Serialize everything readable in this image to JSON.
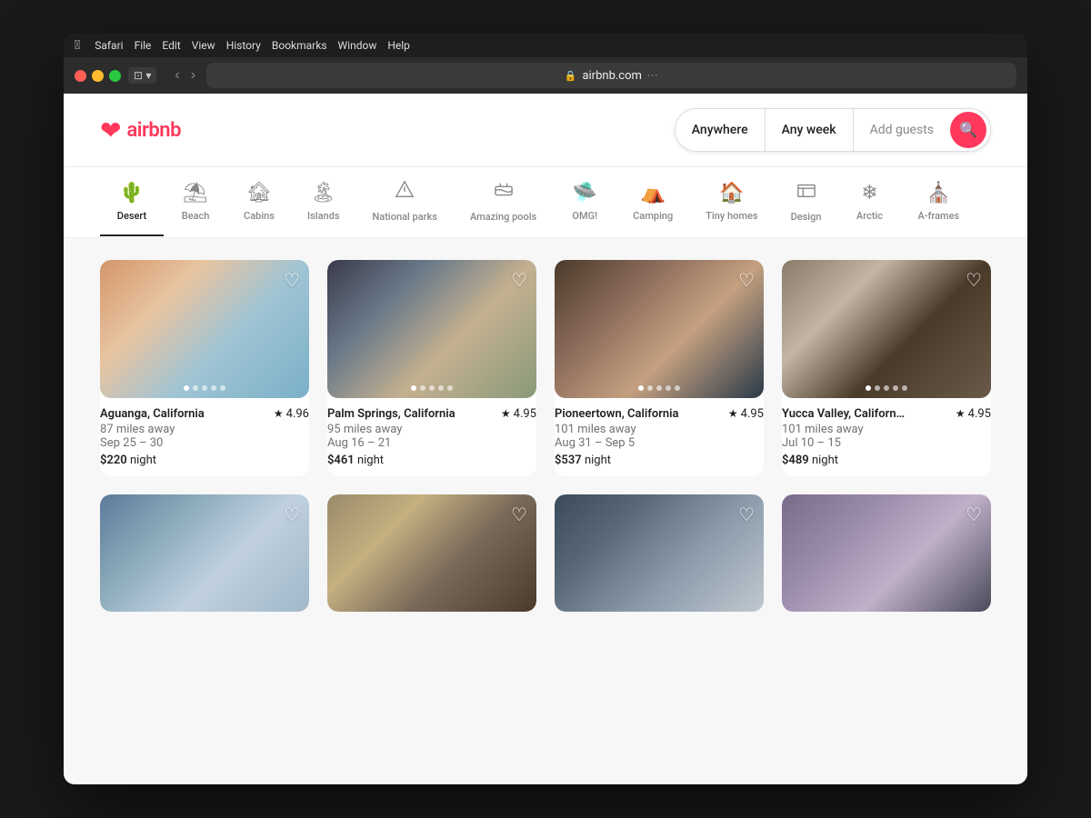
{
  "menubar": {
    "apple": "🍎",
    "items": [
      "Safari",
      "File",
      "Edit",
      "View",
      "History",
      "Bookmarks",
      "Window",
      "Help"
    ]
  },
  "toolbar": {
    "url": "airbnb.com"
  },
  "header": {
    "logo_text": "airbnb",
    "search": {
      "anywhere": "Anywhere",
      "any_week": "Any week",
      "guests": "Add guests"
    }
  },
  "categories": [
    {
      "id": "desert",
      "label": "Desert",
      "icon": "🌵",
      "active": true
    },
    {
      "id": "beach",
      "label": "Beach",
      "icon": "⛱",
      "active": false
    },
    {
      "id": "cabins",
      "label": "Cabins",
      "icon": "🏚",
      "active": false
    },
    {
      "id": "islands",
      "label": "Islands",
      "icon": "🏝",
      "active": false
    },
    {
      "id": "national-parks",
      "label": "National parks",
      "icon": "🏔",
      "active": false
    },
    {
      "id": "amazing-pools",
      "label": "Amazing pools",
      "icon": "🏊",
      "active": false
    },
    {
      "id": "omg",
      "label": "OMG!",
      "icon": "🛸",
      "active": false
    },
    {
      "id": "camping",
      "label": "Camping",
      "icon": "⛺",
      "active": false
    },
    {
      "id": "tiny-homes",
      "label": "Tiny homes",
      "icon": "🏠",
      "active": false
    },
    {
      "id": "design",
      "label": "Design",
      "icon": "🏛",
      "active": false
    },
    {
      "id": "arctic",
      "label": "Arctic",
      "icon": "❄",
      "active": false
    },
    {
      "id": "a-frames",
      "label": "A-frames",
      "icon": "⛪",
      "active": false
    }
  ],
  "listings": [
    {
      "id": "aguanga",
      "location": "Aguanga, California",
      "rating": "4.96",
      "distance": "87 miles away",
      "dates": "Sep 25 – 30",
      "price": "$220",
      "price_unit": "night",
      "img_class": "img-aguanga",
      "dots": 5,
      "active_dot": 0
    },
    {
      "id": "palm-springs",
      "location": "Palm Springs, California",
      "rating": "4.95",
      "distance": "95 miles away",
      "dates": "Aug 16 – 21",
      "price": "$461",
      "price_unit": "night",
      "img_class": "img-palmsprings",
      "dots": 5,
      "active_dot": 0
    },
    {
      "id": "pioneertown",
      "location": "Pioneertown, California",
      "rating": "4.95",
      "distance": "101 miles away",
      "dates": "Aug 31 – Sep 5",
      "price": "$537",
      "price_unit": "night",
      "img_class": "img-pioneertown",
      "dots": 5,
      "active_dot": 0
    },
    {
      "id": "yucca-valley",
      "location": "Yucca Valley, Californ…",
      "rating": "4.95",
      "distance": "101 miles away",
      "dates": "Jul 10 – 15",
      "price": "$489",
      "price_unit": "night",
      "img_class": "img-yucca",
      "dots": 5,
      "active_dot": 0
    },
    {
      "id": "bottom1",
      "location": "",
      "rating": "",
      "distance": "",
      "dates": "",
      "price": "",
      "price_unit": "",
      "img_class": "img-bottom1",
      "dots": 5,
      "active_dot": 0
    },
    {
      "id": "bottom2",
      "location": "",
      "rating": "",
      "distance": "",
      "dates": "",
      "price": "",
      "price_unit": "",
      "img_class": "img-bottom2",
      "dots": 5,
      "active_dot": 0
    },
    {
      "id": "bottom3",
      "location": "",
      "rating": "",
      "distance": "",
      "dates": "",
      "price": "",
      "price_unit": "",
      "img_class": "img-bottom3",
      "dots": 5,
      "active_dot": 0
    },
    {
      "id": "bottom4",
      "location": "",
      "rating": "",
      "distance": "",
      "dates": "",
      "price": "",
      "price_unit": "",
      "img_class": "img-bottom4",
      "dots": 5,
      "active_dot": 0
    }
  ]
}
